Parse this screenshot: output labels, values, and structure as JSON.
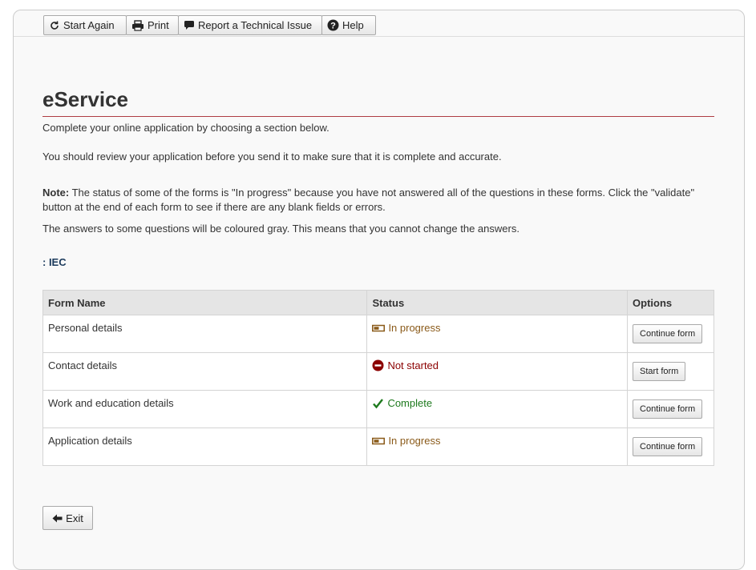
{
  "toolbar": {
    "start_again": "Start Again",
    "print": "Print",
    "report": "Report a Technical Issue",
    "help": "Help"
  },
  "page": {
    "title": "eService",
    "intro": "Complete your online application by choosing a section below.",
    "review": "You should review your application before you send it to make sure that it is complete and accurate.",
    "note_label": "Note:",
    "note_text": " The status of some of the forms is \"In progress\" because you have not answered all of the questions in these forms. Click the \"validate\" button at the end of each form to see if there are any blank fields or errors.",
    "gray_note": "The answers to some questions will be coloured gray. This means that you cannot change the answers.",
    "section_label": ": IEC"
  },
  "table": {
    "headers": {
      "form_name": "Form Name",
      "status": "Status",
      "options": "Options"
    },
    "rows": [
      {
        "form": "Personal details",
        "status": "In progress",
        "status_icon": "in-progress-icon",
        "action": "Continue form"
      },
      {
        "form": "Contact details",
        "status": "Not started",
        "status_icon": "not-started-icon",
        "action": "Start form"
      },
      {
        "form": "Work and education details",
        "status": "Complete",
        "status_icon": "checkmark-icon",
        "action": "Continue form"
      },
      {
        "form": "Application details",
        "status": "In progress",
        "status_icon": "in-progress-icon",
        "action": "Continue form"
      }
    ]
  },
  "footer": {
    "exit": "Exit"
  },
  "colors": {
    "title_rule": "#af3c43",
    "in_progress": "#8a5a19",
    "not_started": "#8b0000",
    "complete": "#1e7a1e",
    "section_label": "#1b3a5c"
  }
}
